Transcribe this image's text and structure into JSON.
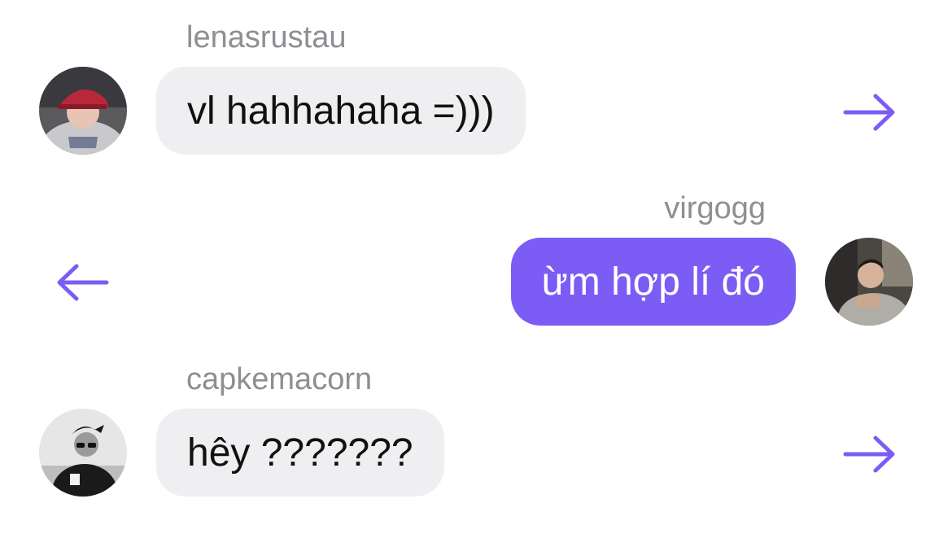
{
  "accent_color": "#7b5cf5",
  "incoming_bubble_color": "#efeff1",
  "username_color": "#8e8e93",
  "messages": [
    {
      "username": "lenasrustau",
      "text": "vl hahhahaha =)))",
      "direction": "incoming",
      "action_icon": "arrow-right-icon"
    },
    {
      "username": "virgogg",
      "text": "ừm hợp lí đó",
      "direction": "outgoing",
      "action_icon": "arrow-left-icon"
    },
    {
      "username": "capkemacorn",
      "text": "hêy ???????",
      "direction": "incoming",
      "action_icon": "arrow-right-icon"
    }
  ]
}
